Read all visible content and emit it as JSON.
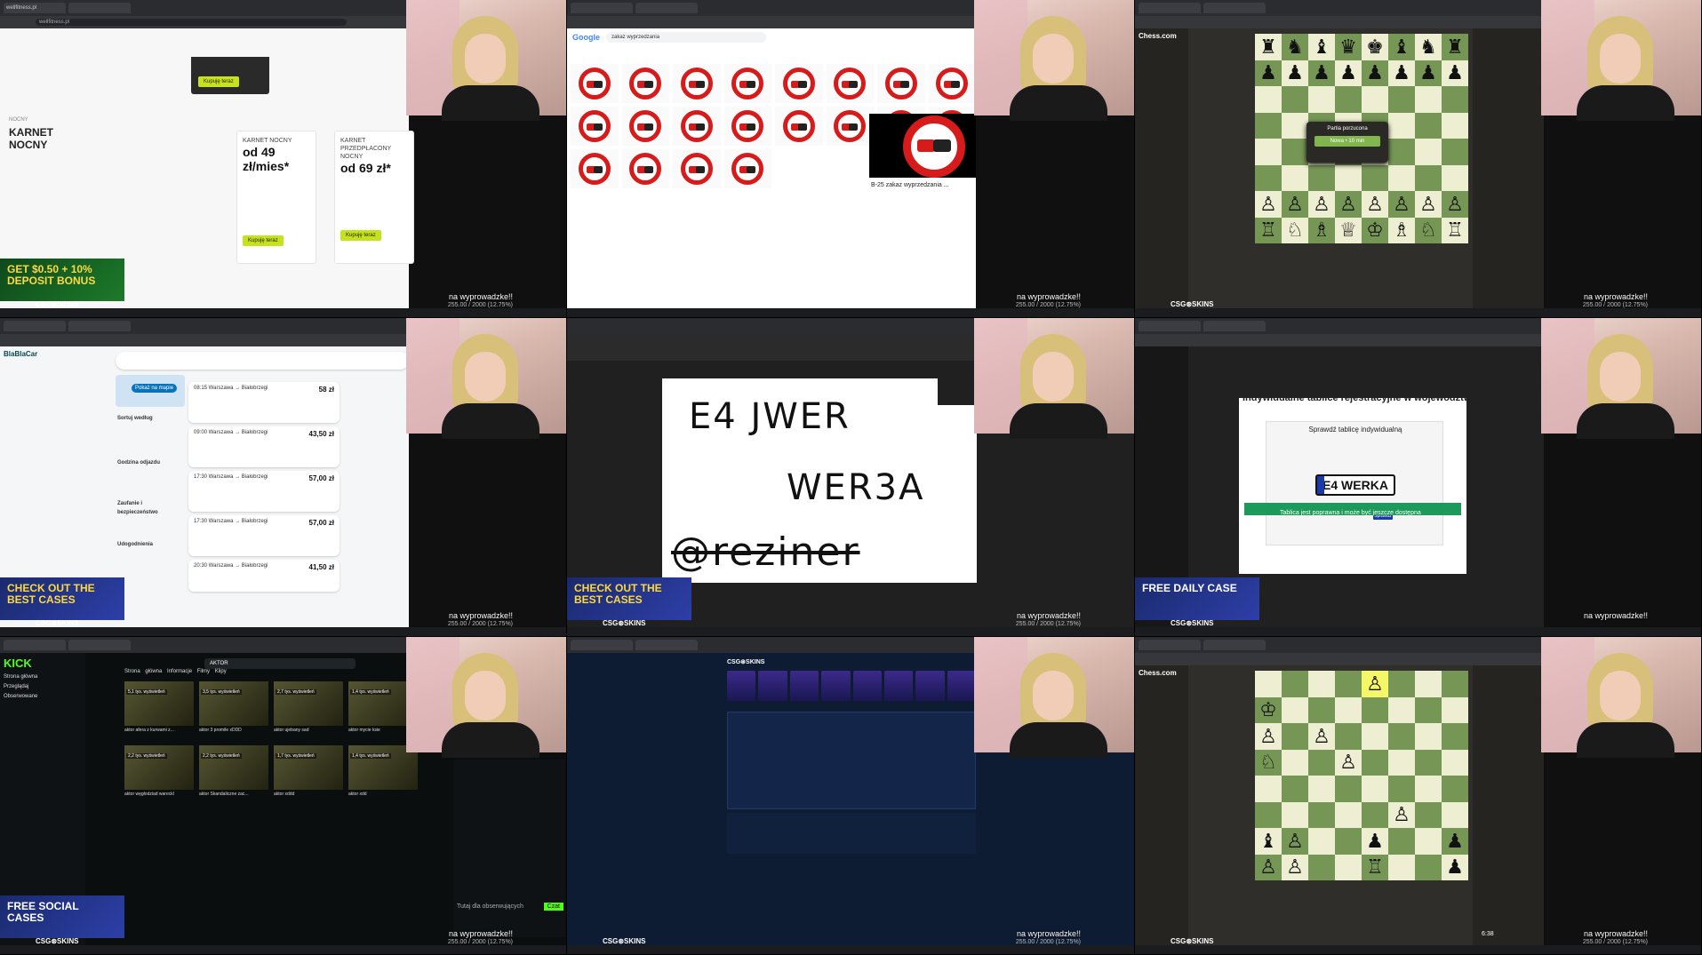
{
  "stream_overlay": {
    "status_text": "na wyprowadzke!!",
    "goal_text": "255.00 / 2000 (12.75%)",
    "sponsor": "CSG⊛SKINS"
  },
  "ads": {
    "deposit": "GET $0.50 + 10% DEPOSIT BONUS",
    "check_cases": "CHECK OUT THE BEST CASES",
    "free_daily": "FREE DAILY CASE",
    "free_social": "FREE SOCIAL CASES"
  },
  "tile_fitness": {
    "url": "wellfitness.pl",
    "label": "NOCNY",
    "heading": "KARNET NOCNY",
    "card1": {
      "title": "KARNET NOCNY",
      "price": "od 49 zł/mies*",
      "button": "Kupuję teraz"
    },
    "card2": {
      "title": "KARNET PRZEDPŁACONY NOCNY",
      "price": "od 69 zł*",
      "button": "Kupuję teraz"
    },
    "top_button": "Kupuję teraz"
  },
  "tile_google": {
    "logo": "Google",
    "query": "zakaz wyprzedzania",
    "result_caption": "B-25 zakaz wyprzedzania ..."
  },
  "tile_chess1": {
    "brand": "Chess.com",
    "modal_title": "Partia porzucona",
    "modal_button": "Nowa • 10 min"
  },
  "tile_blablacar": {
    "logo": "BlaBlaCar",
    "map_button": "Pokaż na mapie",
    "filters": [
      "Sortuj według",
      "Godzina odjazdu",
      "Zaufanie i bezpieczeństwo",
      "Udogodnienia"
    ],
    "rides": [
      {
        "time": "08:15 Warszawa → Białobrzegi",
        "price": "58 zł"
      },
      {
        "time": "09:00 Warszawa → Białobrzegi",
        "price": "43,50 zł"
      },
      {
        "time": "17:30 Warszawa → Białobrzegi",
        "price": "57,00 zł"
      },
      {
        "time": "17:30 Warszawa → Białobrzegi",
        "price": "57,00 zł"
      },
      {
        "time": "20:30 Warszawa → Białobrzegi",
        "price": "41,50 zł"
      }
    ]
  },
  "tile_paint": {
    "line1": "E4 JWER",
    "line2": "WER3A",
    "line3": "@reziner"
  },
  "tile_chatgpt": {
    "heading": "Indywidualne tablice rejestracyjne w województwie łódzkim",
    "check_title": "Sprawdź tablicę indywidualną",
    "plate": "E4 WERKA",
    "check_button": "Sprawdź",
    "result": "Tablica jest poprawna i może być jeszcze dostępna"
  },
  "tile_kick": {
    "brand": "KICK",
    "nav": [
      "Strona główna",
      "Przeglądaj",
      "Obserwowane"
    ],
    "search": "AKTOR",
    "tabs": "Strona główna  Informacje  Filmy  Klipy",
    "clips": [
      {
        "views": "5,1 tys. wyświetleń",
        "title": "aktor afera z kurwami z..."
      },
      {
        "views": "3,5 tys. wyświetleń",
        "title": "aktor 3 promile xDDD"
      },
      {
        "views": "2,7 tys. wyświetleń",
        "title": "aktor ujebany sad"
      },
      {
        "views": "1,4 tys. wyświetleń",
        "title": "aktor mycie ksie"
      },
      {
        "views": "2,2 tys. wyświetleń",
        "title": "aktor węgłodziad wareckl"
      },
      {
        "views": "2,2 tys. wyświetleń",
        "title": "aktor Skandaliczne zac..."
      },
      {
        "views": "1,7 tys. wyświetleń",
        "title": "aktor xddd"
      },
      {
        "views": "1,4 tys. wyświetleń",
        "title": "aktor xdd"
      }
    ],
    "chat_input": "Tutaj dla obserwujących",
    "chat_send": "Czat"
  },
  "tile_csgo": {
    "logo": "CSG⊛SKINS"
  },
  "tile_chess2": {
    "brand": "Chess.com",
    "clock": "6:38"
  }
}
